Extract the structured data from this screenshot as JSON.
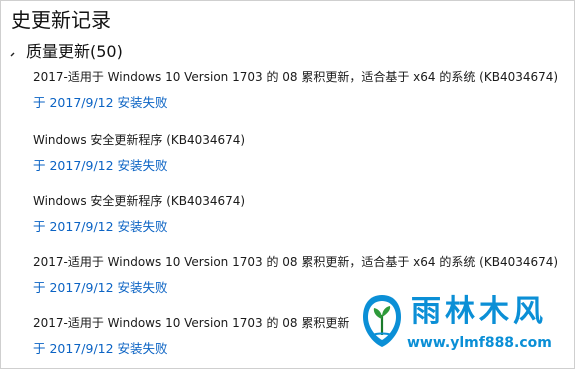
{
  "page_title": "史更新记录",
  "section": {
    "label": "质量更新(50)",
    "icon": "chevron-down-icon"
  },
  "updates": [
    {
      "title": "2017-适用于 Windows 10 Version 1703 的 08 累积更新，适合基于 x64 的系统 (KB4034674)",
      "status": "于 2017/9/12 安装失败"
    },
    {
      "title": "Windows 安全更新程序 (KB4034674)",
      "status": "于 2017/9/12 安装失败"
    },
    {
      "title": "Windows 安全更新程序 (KB4034674)",
      "status": "于 2017/9/12 安装失败"
    },
    {
      "title": "2017-适用于 Windows 10 Version 1703 的 08 累积更新，适合基于 x64 的系统 (KB4034674)",
      "status": "于 2017/9/12 安装失败"
    },
    {
      "title": "2017-适用于 Windows 10 Version 1703 的 08 累积更新",
      "status": "于 2017/9/12 安装失败"
    }
  ],
  "watermark": {
    "brand": "雨林木风",
    "url": "www.ylmf888.com",
    "color": "#0b8fd6"
  },
  "colors": {
    "link": "#0b63c4",
    "text": "#1a1a1a"
  }
}
